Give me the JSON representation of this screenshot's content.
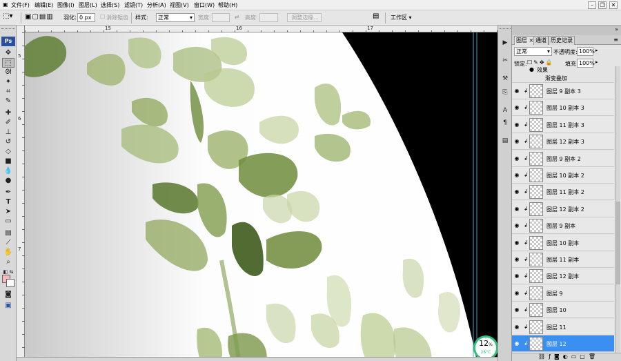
{
  "menu": {
    "items": [
      "文件(F)",
      "编辑(E)",
      "图像(I)",
      "图层(L)",
      "选择(S)",
      "滤镜(T)",
      "分析(A)",
      "视图(V)",
      "窗口(W)",
      "帮助(H)"
    ]
  },
  "window_controls": {
    "minimize": "–",
    "restore": "❐",
    "close": "✕"
  },
  "options_bar": {
    "feather_label": "羽化:",
    "feather_value": "0 px",
    "antialias_label": "消除锯齿",
    "style_label": "样式:",
    "style_value": "正常",
    "width_label": "宽度:",
    "height_label": "高度:",
    "refine_edge_label": "调整边缘...",
    "workspace_label": "工作区 ▾"
  },
  "toolbox": {
    "logo": "Ps",
    "tools": [
      "move",
      "marquee",
      "lasso",
      "magic-wand",
      "crop",
      "slice",
      "healing",
      "brush",
      "clone-stamp",
      "history-brush",
      "eraser",
      "gradient",
      "blur",
      "dodge",
      "pen",
      "type",
      "path-select",
      "shape",
      "notes",
      "eyedropper",
      "hand",
      "zoom"
    ],
    "foreground_color": "#f7b8b8",
    "background_color": "#ffffff"
  },
  "rulers": {
    "h_labels": [
      "15",
      "16",
      "17"
    ],
    "v_labels": [
      "5",
      "6",
      "7"
    ]
  },
  "layers_panel": {
    "tabs": [
      "图层",
      "通道",
      "历史记录"
    ],
    "blend_mode": "正常",
    "opacity_label": "不透明度:",
    "opacity_value": "100%",
    "lock_label": "锁定:",
    "fill_label": "填充:",
    "fill_value": "100%",
    "effects_label": "效果",
    "effect_item": "渐变叠加",
    "layers": [
      {
        "name": "图层 9 副本 3",
        "selected": false
      },
      {
        "name": "图层 10 副本 3",
        "selected": false
      },
      {
        "name": "图层 11 副本 3",
        "selected": false
      },
      {
        "name": "图层 12 副本 3",
        "selected": false
      },
      {
        "name": "图层 9 副本 2",
        "selected": false
      },
      {
        "name": "图层 10 副本 2",
        "selected": false
      },
      {
        "name": "图层 11 副本 2",
        "selected": false
      },
      {
        "name": "图层 12 副本 2",
        "selected": false
      },
      {
        "name": "图层 9 副本",
        "selected": false
      },
      {
        "name": "图层 10 副本",
        "selected": false
      },
      {
        "name": "图层 11 副本",
        "selected": false
      },
      {
        "name": "图层 12 副本",
        "selected": false
      },
      {
        "name": "图层 9",
        "selected": false
      },
      {
        "name": "图层 10",
        "selected": false
      },
      {
        "name": "图层 11",
        "selected": false
      },
      {
        "name": "图层 12",
        "selected": true
      }
    ]
  },
  "gauge": {
    "percent": "12",
    "unit": "%",
    "temperature": "26°C"
  },
  "colors": {
    "selection": "#3a8ff0",
    "leaf": "#8fa85a",
    "leaf_dark": "#4d6a26",
    "canvas_bg": "#000000",
    "gauge_ring": "#2ec07a"
  }
}
